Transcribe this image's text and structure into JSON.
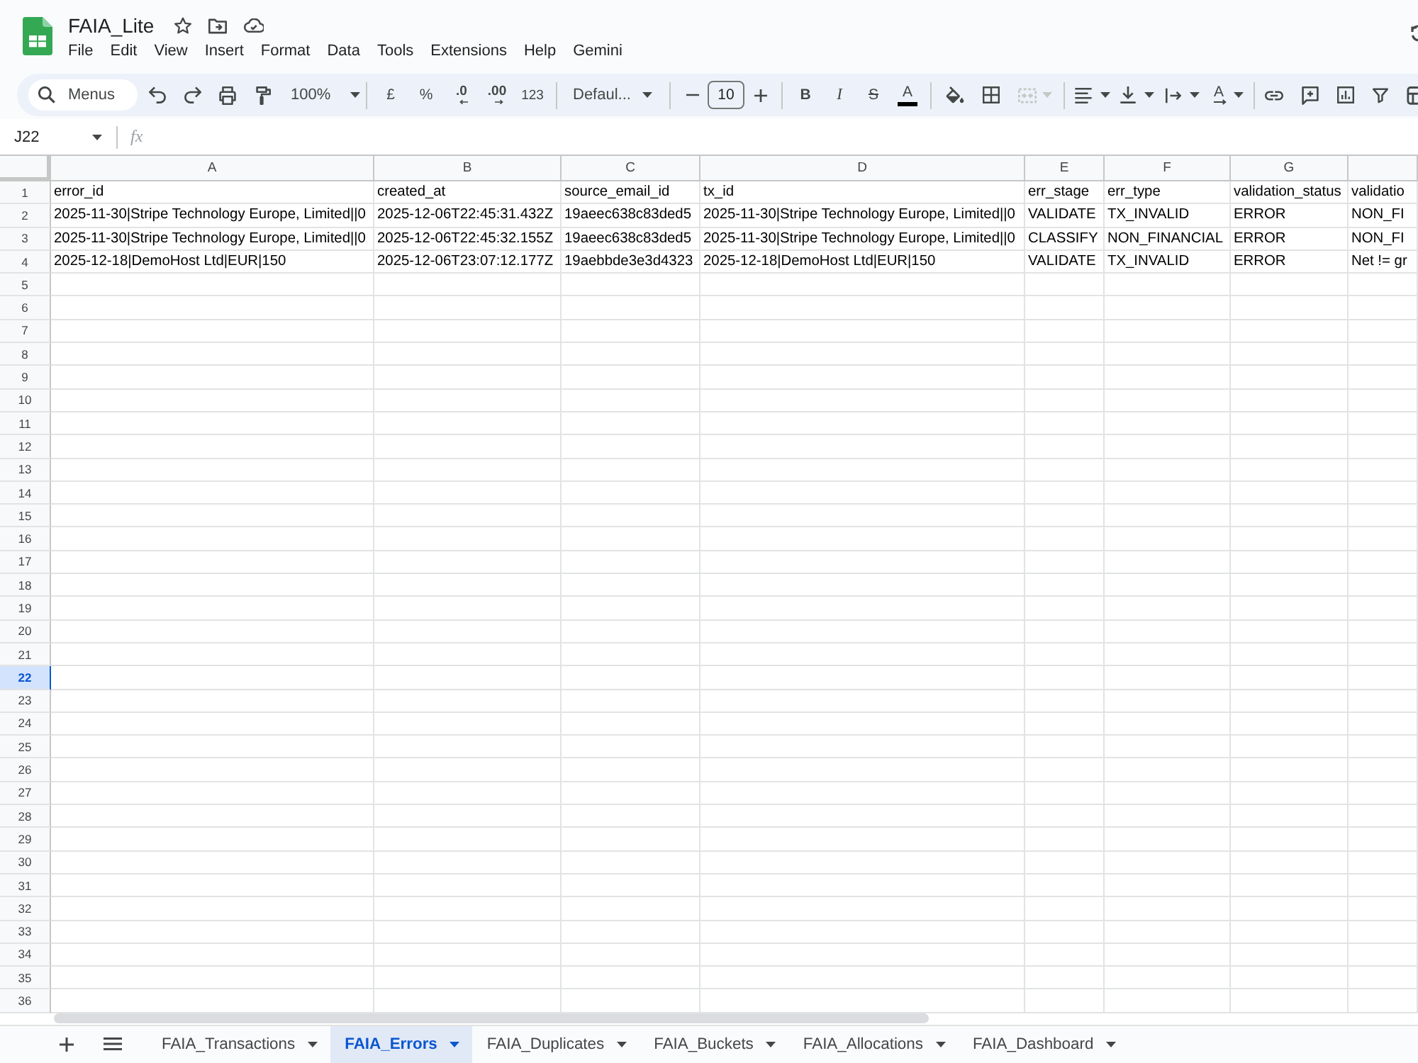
{
  "document": {
    "title": "FAIA_Lite"
  },
  "menu": [
    "File",
    "Edit",
    "View",
    "Insert",
    "Format",
    "Data",
    "Tools",
    "Extensions",
    "Help",
    "Gemini"
  ],
  "toolbar": {
    "search": {
      "placeholder": "Menus"
    },
    "zoom": "100%",
    "currency": "£",
    "percent": "%",
    "decrease_decimal": ".0",
    "increase_decimal": ".00",
    "number_format": "123",
    "font": "Defaul...",
    "font_size": "10",
    "bold": "B",
    "italic": "I",
    "strikethrough": "S",
    "text_color": "A",
    "merge": {
      "disabled": true
    },
    "text_rotation": "A"
  },
  "formula_bar": {
    "name_box": "J22",
    "label": "fx"
  },
  "sheet": {
    "columns": [
      {
        "letter": "A"
      },
      {
        "letter": "B"
      },
      {
        "letter": "C"
      },
      {
        "letter": "D"
      },
      {
        "letter": "E"
      },
      {
        "letter": "F"
      },
      {
        "letter": "G"
      }
    ],
    "rows": [
      {
        "number": "1",
        "selected": false,
        "cells": [
          "error_id",
          "created_at",
          "source_email_id",
          "tx_id",
          "err_stage",
          "err_type",
          "validation_status",
          "validatio"
        ]
      },
      {
        "number": "2",
        "selected": false,
        "cells": [
          "2025-11-30|Stripe Technology Europe, Limited||0",
          "2025-12-06T22:45:31.432Z",
          "19aeec638c83ded5",
          "2025-11-30|Stripe Technology Europe, Limited||0",
          "VALIDATE",
          "TX_INVALID",
          "ERROR",
          "NON_FI"
        ]
      },
      {
        "number": "3",
        "selected": false,
        "cells": [
          "2025-11-30|Stripe Technology Europe, Limited||0",
          "2025-12-06T22:45:32.155Z",
          "19aeec638c83ded5",
          "2025-11-30|Stripe Technology Europe, Limited||0",
          "CLASSIFY",
          "NON_FINANCIAL",
          "ERROR",
          "NON_FI"
        ]
      },
      {
        "number": "4",
        "selected": false,
        "cells": [
          "2025-12-18|DemoHost Ltd|EUR|150",
          "2025-12-06T23:07:12.177Z",
          "19aebbde3e3d4323",
          "2025-12-18|DemoHost Ltd|EUR|150",
          "VALIDATE",
          "TX_INVALID",
          "ERROR",
          "Net != gr"
        ]
      },
      {
        "number": "5",
        "selected": false
      },
      {
        "number": "6",
        "selected": false
      },
      {
        "number": "7",
        "selected": false
      },
      {
        "number": "8",
        "selected": false
      },
      {
        "number": "9",
        "selected": false
      },
      {
        "number": "10",
        "selected": false
      },
      {
        "number": "11",
        "selected": false
      },
      {
        "number": "12",
        "selected": false
      },
      {
        "number": "13",
        "selected": false
      },
      {
        "number": "14",
        "selected": false
      },
      {
        "number": "15",
        "selected": false
      },
      {
        "number": "16",
        "selected": false
      },
      {
        "number": "17",
        "selected": false
      },
      {
        "number": "18",
        "selected": false
      },
      {
        "number": "19",
        "selected": false
      },
      {
        "number": "20",
        "selected": false
      },
      {
        "number": "21",
        "selected": false
      },
      {
        "number": "22",
        "selected": true
      },
      {
        "number": "23",
        "selected": false
      },
      {
        "number": "24",
        "selected": false
      },
      {
        "number": "25",
        "selected": false
      },
      {
        "number": "26",
        "selected": false
      },
      {
        "number": "27",
        "selected": false
      },
      {
        "number": "28",
        "selected": false
      },
      {
        "number": "29",
        "selected": false
      },
      {
        "number": "30",
        "selected": false
      },
      {
        "number": "31",
        "selected": false
      },
      {
        "number": "32",
        "selected": false
      },
      {
        "number": "33",
        "selected": false
      },
      {
        "number": "34",
        "selected": false
      },
      {
        "number": "35",
        "selected": false
      },
      {
        "number": "36",
        "selected": false
      }
    ]
  },
  "sheet_tabs": [
    {
      "name": "FAIA_Transactions",
      "selected": false
    },
    {
      "name": "FAIA_Errors",
      "selected": true
    },
    {
      "name": "FAIA_Duplicates",
      "selected": false
    },
    {
      "name": "FAIA_Buckets",
      "selected": false
    },
    {
      "name": "FAIA_Allocations",
      "selected": false
    },
    {
      "name": "FAIA_Dashboard",
      "selected": false
    }
  ]
}
